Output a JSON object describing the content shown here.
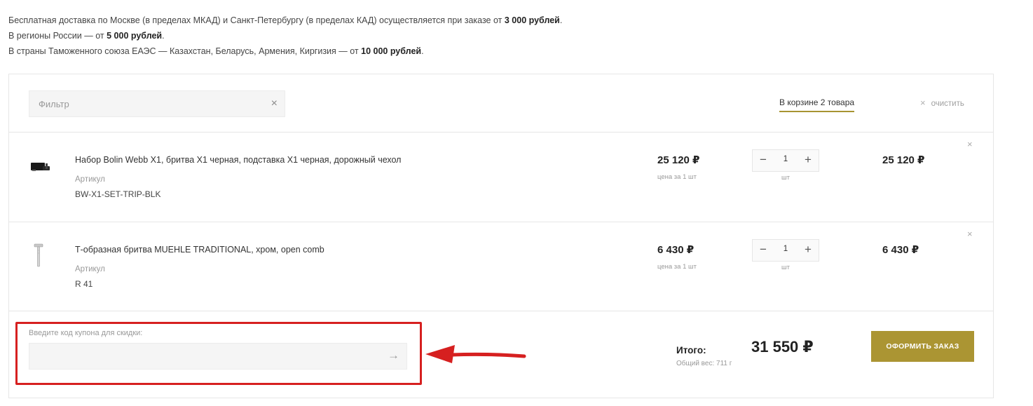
{
  "shipping_info": {
    "line1_text": "Бесплатная доставка по Москве (в пределах МКАД) и Санкт-Петербургу (в пределах КАД) осуществляется при заказе от ",
    "line1_amount": "3 000 рублей",
    "line2_text": "В регионы России — от ",
    "line2_amount": "5 000 рублей",
    "line3_text": "В страны Таможенного союза ЕАЭС — Казахстан, Беларусь, Армения, Киргизия — от ",
    "line3_amount": "10 000 рублей",
    "period": "."
  },
  "toolbar": {
    "filter_placeholder": "Фильтр",
    "filter_clear_icon": "×",
    "cart_count": "В корзине 2 товара",
    "clear_icon": "×",
    "clear_label": "очистить"
  },
  "items": [
    {
      "name": "Набор Bolin Webb X1, бритва X1 черная, подставка X1 черная, дорожный чехол",
      "sku_label": "Артикул",
      "sku": "BW-X1-SET-TRIP-BLK",
      "price": "25 120 ₽",
      "price_note": "цена за 1 шт",
      "qty": "1",
      "unit": "шт",
      "total": "25 120 ₽",
      "thumb_icon": "razor-set-icon"
    },
    {
      "name": "Т-образная бритва MUEHLE TRADITIONAL, хром, open comb",
      "sku_label": "Артикул",
      "sku": "R 41",
      "price": "6 430 ₽",
      "price_note": "цена за 1 шт",
      "qty": "1",
      "unit": "шт",
      "total": "6 430 ₽",
      "thumb_icon": "safety-razor-icon"
    }
  ],
  "stepper": {
    "minus": "−",
    "plus": "+",
    "remove": "×"
  },
  "footer": {
    "coupon_label": "Введите код купона для скидки:",
    "coupon_go": "→",
    "sum_label": "Итого:",
    "weight": "Общий вес: 711 г",
    "sum_value": "31 550 ₽",
    "order_button": "ОФОРМИТЬ ЗАКАЗ"
  },
  "colors": {
    "accent": "#ab9533",
    "annotation": "#d62020",
    "border": "#e6e6e6"
  }
}
